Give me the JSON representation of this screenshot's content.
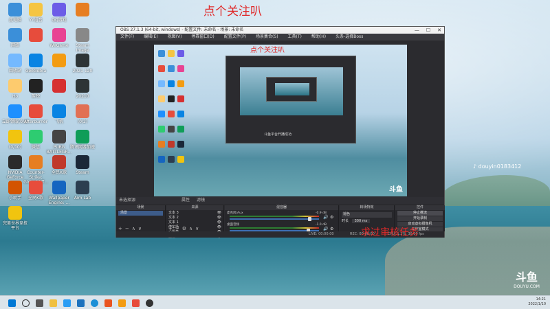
{
  "overlay": {
    "top_text": "点个关注叭",
    "inner_top_text": "点个关注叭",
    "bottom_text": "求过审核任务",
    "tiktok_id": "douyin0183412",
    "douyu_brand": "DOUYU.COM"
  },
  "desktop_icons": [
    {
      "label": "此电脑",
      "color": "#3b8fd9"
    },
    {
      "label": "YY语音",
      "color": "#f5c542"
    },
    {
      "label": "QQ游戏",
      "color": "#6c5ce7"
    },
    {
      "label": "",
      "color": "#e67e22"
    },
    {
      "label": "网络",
      "color": "#3b8fd9"
    },
    {
      "label": "",
      "color": "#e74c3c"
    },
    {
      "label": "WeGame",
      "color": "#e84393"
    },
    {
      "label": "Steam Image",
      "color": "#888888"
    },
    {
      "label": "回收站",
      "color": "#74b9ff"
    },
    {
      "label": "GeoGebra",
      "color": "#0984e3"
    },
    {
      "label": "",
      "color": "#f39c12"
    },
    {
      "label": "2021 120",
      "color": "#2d3436"
    },
    {
      "label": "Ho",
      "color": "#fdcb6e"
    },
    {
      "label": "剪映",
      "color": "#222222"
    },
    {
      "label": "",
      "color": "#d63031"
    },
    {
      "label": "20210",
      "color": "#2d3436"
    },
    {
      "label": "立即领取(0/1)",
      "color": "#1e90ff"
    },
    {
      "label": "Afterburner",
      "color": "#e74c3c"
    },
    {
      "label": "飞机",
      "color": "#0984e3"
    },
    {
      "label": "(0/2)",
      "color": "#e17055"
    },
    {
      "label": "(0/10)",
      "color": "#f1c40f"
    },
    {
      "label": "微信",
      "color": "#2ecc71"
    },
    {
      "label": "PUBG BATTLEGR...",
      "color": "#444444"
    },
    {
      "label": "腾讯网游加速",
      "color": "#0f9d58"
    },
    {
      "label": "NVIDIA GeForce",
      "color": "#2b2b2b"
    },
    {
      "label": "Counter-Strike: Global Off...",
      "color": "#e67e22"
    },
    {
      "label": "全民K歌",
      "color": "#c0392b"
    },
    {
      "label": "Steam",
      "color": "#1b2838"
    },
    {
      "label": "小助手",
      "color": "#d35400"
    },
    {
      "label": "全民K歌",
      "color": "#e74c3c"
    },
    {
      "label": "Wallpaper Engine: ...",
      "color": "#1565c0"
    },
    {
      "label": "Aim Lab",
      "color": "#2c3e50"
    },
    {
      "label": "完美世界竞技平台",
      "color": "#f1c40f"
    }
  ],
  "obs": {
    "title": "OBS 27.1.3 (64-bit, windows) - 配置文件: 未命名 - 场景: 未命名",
    "window_controls": [
      "—",
      "☐",
      "✕"
    ],
    "menu": [
      "文件(F)",
      "编辑(E)",
      "视图(V)",
      "停靠窗口(D)",
      "配置文件(P)",
      "场景集合(S)",
      "工具(T)",
      "帮助(H)",
      "头条-选择Boss"
    ],
    "scene_bar_label": "未选择源",
    "scene_bar_buttons": [
      "属性",
      "滤镜"
    ],
    "docks": {
      "scenes": {
        "title": "场景",
        "items": [
          "场景"
        ]
      },
      "sources": {
        "title": "来源",
        "items": [
          "文本 3",
          "文本 2",
          "文本 1",
          "停车场",
          "心愿单",
          "直播"
        ]
      },
      "mixer": {
        "title": "混音器",
        "channels": [
          {
            "name": "麦克风/Aux",
            "db": "-0.9 dB",
            "level": 0.88
          },
          {
            "name": "桌面音频",
            "db": "-1.0 dB",
            "level": 0.86
          }
        ]
      },
      "transitions": {
        "title": "转场特效",
        "type": "褪色",
        "duration_label": "时长",
        "duration": "300 ms"
      },
      "controls": {
        "title": "控件",
        "buttons": [
          "停止推流",
          "开始录制",
          "启动虚拟摄像机",
          "工作室模式",
          "设置",
          "退出"
        ]
      }
    },
    "status": {
      "live": "LIVE: 00:00:00",
      "rec": "REC: 00:00:00",
      "cpu": "CPU: 1.2%, 30.00 fps"
    },
    "inner_caption": "斗鱼平台开播成功"
  },
  "taskbar": {
    "time": "14:21",
    "date": "2022/1/10"
  }
}
